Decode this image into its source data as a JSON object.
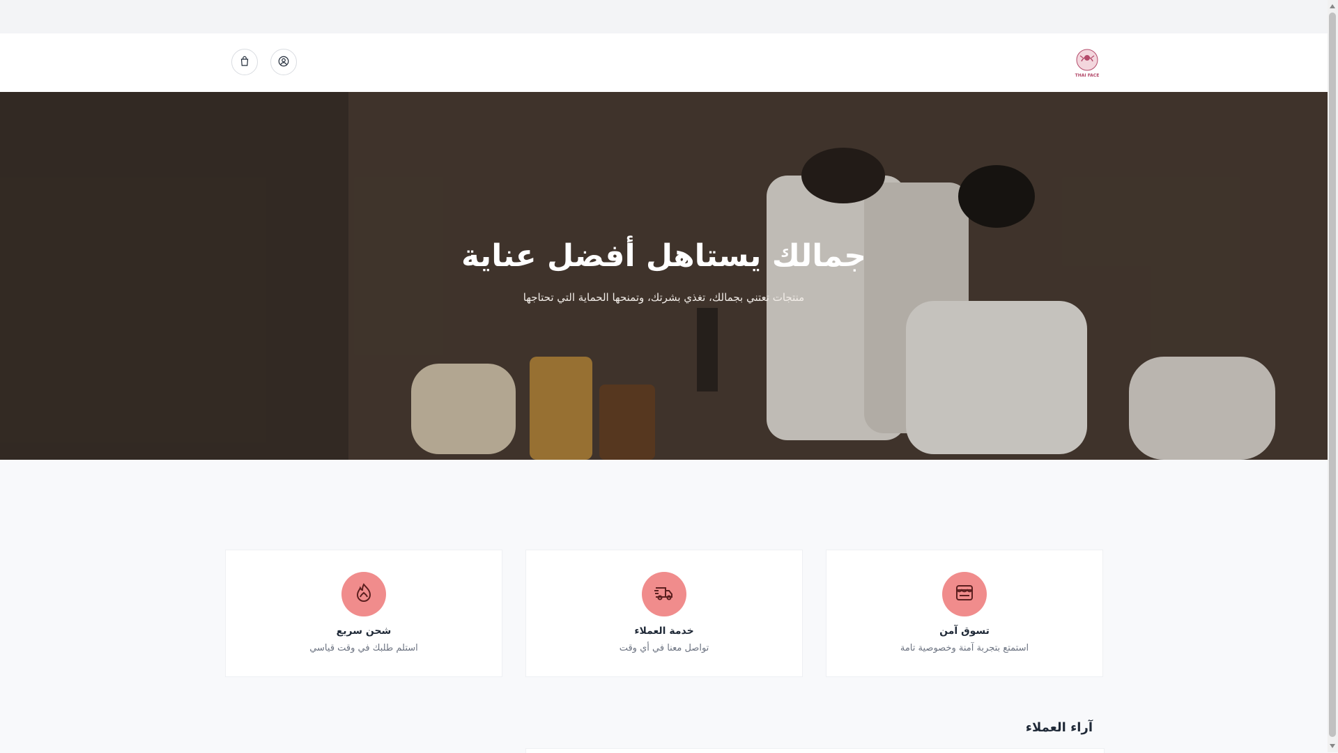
{
  "header": {
    "logo_text": "THAI FACE",
    "cart_icon": "shopping-bag-icon",
    "account_icon": "user-icon"
  },
  "hero": {
    "title": "جمالك يستاهل أفضل عناية",
    "subtitle": "منتجات تعتني بجمالك، تغذي بشرتك، وتمنحها الحماية التي تحتاجها"
  },
  "features": [
    {
      "title": "تسوق آمن",
      "subtitle": "استمتع بتجربة آمنة وخصوصية تامة",
      "icon": "store-icon"
    },
    {
      "title": "خدمة العملاء",
      "subtitle": "تواصل معنا في أي وقت",
      "icon": "truck-icon"
    },
    {
      "title": "شحن سريع",
      "subtitle": "استلم طلبك في وقت قياسي",
      "icon": "flame-icon"
    }
  ],
  "reviews": {
    "heading": "آراء العملاء"
  },
  "colors": {
    "accent": "#f08c8c",
    "icon_stroke": "#5b1f1f"
  }
}
